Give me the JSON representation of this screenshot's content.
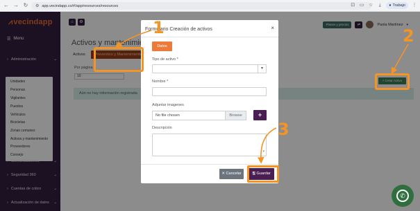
{
  "browser": {
    "url": "app.vecindapp.co/#/app/resources/resources",
    "profile": "Trabajo"
  },
  "sidebar": {
    "logo_text": "vecindapp",
    "menu_label": "Menu",
    "admin_label": "Administración",
    "admin_items": [
      "Unidades",
      "Personas",
      "Vigilantes",
      "Puestos",
      "Vehículos",
      "Bicicletas",
      "Zonas comunes",
      "Activos y mantenimiento",
      "Proveedores",
      "Consejo"
    ],
    "sections": [
      "Comunicaciones",
      "Seguridad 360",
      "Cuentas de cobro",
      "Actualización de datos"
    ]
  },
  "header": {
    "plans_button": "Planes y precios",
    "user_name": "Paola Martínez"
  },
  "page": {
    "title": "Activos y mantenimiento",
    "tab_activos": "Activos",
    "tab_preventivo": "Preventivo y Mantenimiento",
    "per_page_label": "Por página",
    "per_page_value": "10",
    "create_button": "+ Crear Activo",
    "empty_message": "Aún no hay información registrada"
  },
  "modal": {
    "title": "Formulario Creación de activos",
    "datos_tab": "Datos",
    "tipo_label": "Tipo de activo *",
    "nombre_label": "Nombre *",
    "imagenes_label": "Adjuntar imagenes",
    "file_placeholder": "No file chosen",
    "browse_label": "Browse",
    "plus_label": "+",
    "descripcion_label": "Descripción",
    "cancel_label": "✕ Cancelar",
    "save_label": "🖫 Guardar"
  },
  "annotations": [
    "1",
    "2",
    "3"
  ],
  "colors": {
    "sidebar_bg": "#341f3f",
    "accent_orange": "#ec7a3a",
    "highlight_orange": "#f39425",
    "primary_purple": "#4b1e53",
    "success_green": "#3e7e57"
  }
}
